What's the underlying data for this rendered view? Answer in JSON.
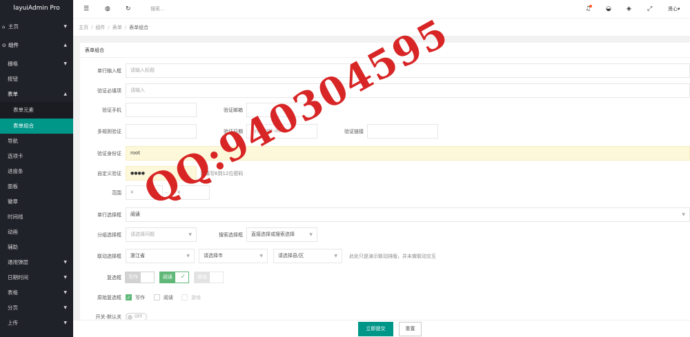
{
  "app": {
    "title": "layuiAdmin Pro"
  },
  "sidebar": {
    "home": "主页",
    "components": "组件",
    "items": {
      "grid": "栅格",
      "button": "按钮",
      "form": "表单",
      "form_elements": "表单元素",
      "form_combo": "表单组合",
      "nav": "导航",
      "tabs": "选项卡",
      "progress": "进度条",
      "panel": "面板",
      "badge": "徽章",
      "timeline": "时间线",
      "anim": "动画",
      "aux": "辅助",
      "popup": "通用弹层",
      "datetime": "日期时间",
      "table": "表格",
      "paging": "分页",
      "upload": "上传"
    }
  },
  "header": {
    "search_placeholder": "搜索...",
    "user": "贤心"
  },
  "breadcrumb": [
    "主页",
    "组件",
    "表单",
    "表单组合"
  ],
  "card": {
    "title": "表单组合"
  },
  "form": {
    "single_input": {
      "label": "单行输入框",
      "placeholder": "请输入标题"
    },
    "required": {
      "label": "验证必填项",
      "placeholder": "请输入"
    },
    "phone": {
      "label": "验证手机"
    },
    "email": {
      "label": "验证邮箱"
    },
    "multi_rule": {
      "label": "多规则验证"
    },
    "date": {
      "label": "验证日期",
      "placeholder": "yyyy-MM-dd"
    },
    "url": {
      "label": "验证链接"
    },
    "id_card": {
      "label": "验证身份证",
      "value": "root"
    },
    "custom": {
      "label": "自定义验证",
      "value": "●●●●",
      "hint": "请填写6到12位密码"
    },
    "range": {
      "label": "范围",
      "from": "¥",
      "to": "¥",
      "sep": "-"
    },
    "single_select": {
      "label": "单行选择框",
      "value": "阅读"
    },
    "group_select": {
      "label": "分组选择框",
      "placeholder": "请选择问题"
    },
    "search_select": {
      "label": "搜索选择框",
      "placeholder": "直接选择或搜索选择"
    },
    "linked_select": {
      "label": "联动选择框",
      "province": "浙江省",
      "city": "请选择市",
      "county": "请选择县/区",
      "hint": "此处只是演示联动排版，并未做联动交互"
    },
    "checkbox": {
      "label": "复选框",
      "items": [
        {
          "text": "写作",
          "checked": false,
          "disabled": false
        },
        {
          "text": "阅读",
          "checked": true,
          "disabled": false
        },
        {
          "text": "游戏",
          "checked": false,
          "disabled": true
        }
      ]
    },
    "raw_checkbox": {
      "label": "原始复选框",
      "items": [
        {
          "text": "写作",
          "checked": true,
          "disabled": false
        },
        {
          "text": "阅读",
          "checked": false,
          "disabled": false
        },
        {
          "text": "游戏",
          "checked": false,
          "disabled": true
        }
      ]
    },
    "switch": {
      "label": "开关-默认关",
      "text": "OFF"
    }
  },
  "actions": {
    "submit": "立即提交",
    "reset": "重置"
  },
  "watermark": "QQ:940304595"
}
